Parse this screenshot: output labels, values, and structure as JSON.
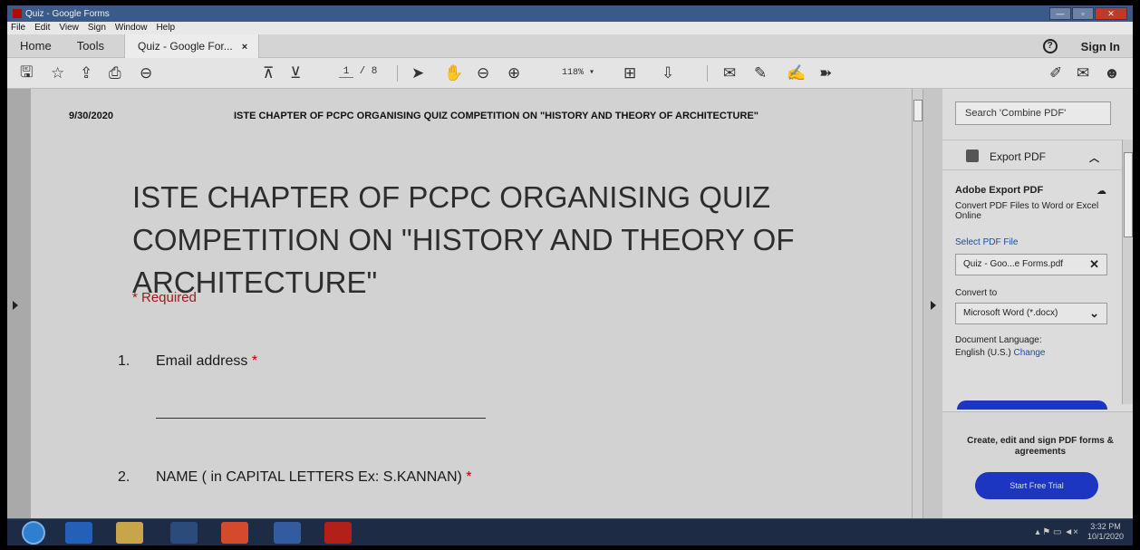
{
  "window": {
    "title": "Quiz - Google Forms"
  },
  "menubar": [
    "File",
    "Edit",
    "View",
    "Sign",
    "Window",
    "Help"
  ],
  "tabs": {
    "home": "Home",
    "tools": "Tools",
    "document": "Quiz - Google For...",
    "close": "×",
    "help": "?",
    "signin": "Sign In"
  },
  "toolbar": {
    "page_current": "1",
    "page_total": "/ 8",
    "zoom": "118%",
    "zoom_arrow": "▾"
  },
  "document": {
    "date": "9/30/2020",
    "header_title": "ISTE CHAPTER OF PCPC ORGANISING QUIZ COMPETITION ON \"HISTORY AND THEORY OF ARCHITECTURE\"",
    "title": "ISTE CHAPTER OF PCPC ORGANISING QUIZ COMPETITION ON \"HISTORY AND THEORY OF ARCHITECTURE\"",
    "required": "* Required",
    "q1": {
      "num": "1.",
      "label": "Email address",
      "star": "*"
    },
    "q2": {
      "num": "2.",
      "label": "NAME ( in CAPITAL LETTERS Ex: S.KANNAN)",
      "star": "*"
    }
  },
  "pane": {
    "search_placeholder": "Search 'Combine PDF'",
    "export_header": "Export PDF",
    "export_title": "Adobe Export PDF",
    "export_desc": "Convert PDF Files to Word or Excel Online",
    "select_label": "Select PDF File",
    "file_name": "Quiz - Goo...e Forms.pdf",
    "file_clear": "✕",
    "convert_label": "Convert to",
    "convert_value": "Microsoft Word (*.docx)",
    "convert_arrow": "⌄",
    "lang_label": "Document Language:",
    "lang_value": "English (U.S.)",
    "lang_change": "Change",
    "promo_text": "Create, edit and sign PDF forms & agreements",
    "promo_button": "Start Free Trial"
  },
  "taskbar": {
    "time": "3:32 PM",
    "date": "10/1/2020"
  }
}
